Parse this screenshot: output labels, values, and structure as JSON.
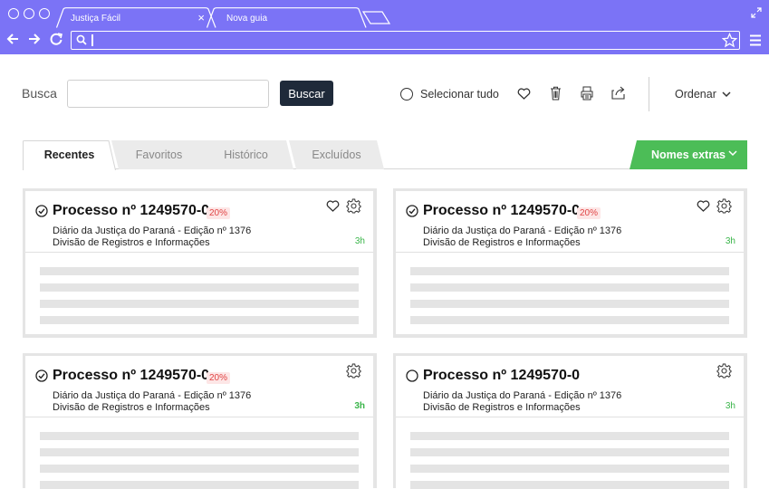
{
  "browser": {
    "tabs": [
      {
        "label": "Justiça Fácil",
        "close": "×"
      },
      {
        "label": "Nova guia"
      }
    ],
    "url": "",
    "colors": {
      "chrome": "#7b73f6"
    }
  },
  "toolbar": {
    "search_label": "Busca",
    "search_value": "",
    "search_button": "Buscar",
    "select_all": "Selecionar tudo",
    "order_label": "Ordenar"
  },
  "tabs": {
    "items": [
      "Recentes",
      "Favoritos",
      "Histórico",
      "Excluídos"
    ],
    "active": "Recentes",
    "extras_button": "Nomes extras",
    "extras_color": "#4cbd57"
  },
  "cards": [
    {
      "title": "Processo nº 1249570-0",
      "badge": "20%",
      "line1": "Diário da Justiça do Paraná - Edição nº 1376",
      "line2": "Divisão de Registros e Informações",
      "time": "3h",
      "checked": true,
      "favorite_icon": true
    },
    {
      "title": "Processo nº 1249570-0",
      "badge": "20%",
      "line1": "Diário da Justiça do Paraná - Edição nº 1376",
      "line2": "Divisão de Registros e Informações",
      "time": "3h",
      "checked": true,
      "favorite_icon": true
    },
    {
      "title": "Processo nº 1249570-0",
      "badge": "20%",
      "line1": "Diário da Justiça do Paraná - Edição nº 1376",
      "line2": "Divisão de Registros e Informações",
      "time": "3h",
      "checked": true,
      "favorite_icon": false
    },
    {
      "title": "Processo nº 1249570-0",
      "badge": "",
      "line1": "Diário da Justiça do Paraná - Edição nº 1376",
      "line2": "Divisão de Registros e Informações",
      "time": "3h",
      "checked": false,
      "favorite_icon": false
    }
  ]
}
